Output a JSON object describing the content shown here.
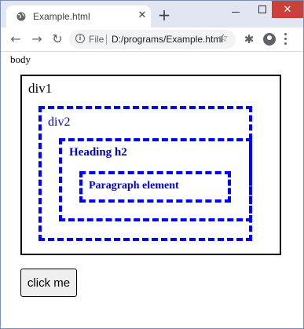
{
  "tab": {
    "title": "Example.html",
    "close_glyph": "✕"
  },
  "toolbar": {
    "file_label": "File",
    "url": "D:/programs/Example.html"
  },
  "page": {
    "body_label": "body",
    "div1_label": "div1",
    "div2_label": "div2",
    "heading_text": "Heading h2",
    "paragraph_text": "Paragraph element",
    "button_label": "click me"
  },
  "colors": {
    "dashed_border": "#0000ff",
    "text_blue": "#0000cc",
    "close_button_bg": "#c8413a"
  },
  "icons": [
    "globe-icon",
    "close-icon",
    "plus-icon",
    "back-arrow-icon",
    "forward-arrow-icon",
    "reload-icon",
    "info-icon",
    "star-icon",
    "puzzle-icon",
    "profile-icon",
    "menu-icon"
  ]
}
